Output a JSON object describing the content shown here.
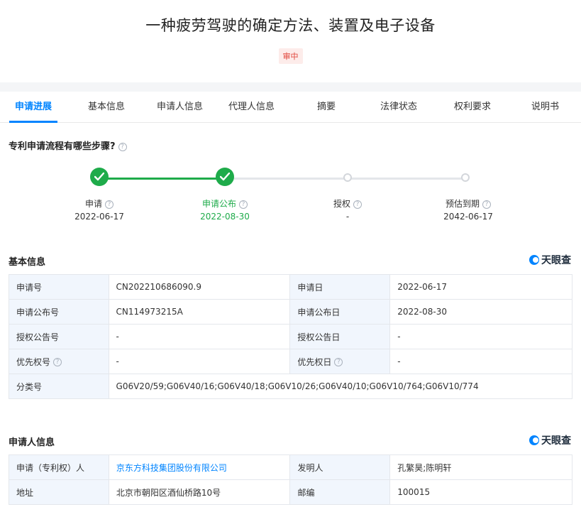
{
  "header": {
    "title": "一种疲劳驾驶的确定方法、装置及电子设备",
    "status": "审中"
  },
  "tabs": [
    "申请进展",
    "基本信息",
    "申请人信息",
    "代理人信息",
    "摘要",
    "法律状态",
    "权利要求",
    "说明书"
  ],
  "progress": {
    "heading": "专利申请流程有哪些步骤?",
    "steps": [
      {
        "label": "申请",
        "date": "2022-06-17",
        "done": true
      },
      {
        "label": "申请公布",
        "date": "2022-08-30",
        "done": true
      },
      {
        "label": "授权",
        "date": "-",
        "done": false
      },
      {
        "label": "预估到期",
        "date": "2042-06-17",
        "done": false
      }
    ]
  },
  "brand": "天眼查",
  "basic_info": {
    "heading": "基本信息",
    "rows": [
      {
        "k1": "申请号",
        "v1": "CN202210686090.9",
        "k2": "申请日",
        "v2": "2022-06-17"
      },
      {
        "k1": "申请公布号",
        "v1": "CN114973215A",
        "k2": "申请公布日",
        "v2": "2022-08-30"
      },
      {
        "k1": "授权公告号",
        "v1": "-",
        "k2": "授权公告日",
        "v2": "-"
      },
      {
        "k1": "优先权号",
        "v1": "-",
        "k2": "优先权日",
        "v2": "-"
      }
    ],
    "classification_label": "分类号",
    "classification_value": "G06V20/59;G06V40/16;G06V40/18;G06V10/26;G06V40/10;G06V10/764;G06V10/774"
  },
  "applicant_info": {
    "heading": "申请人信息",
    "applicant_label": "申请（专利权）人",
    "applicant_value": "京东方科技集团股份有限公司",
    "inventor_label": "发明人",
    "inventor_value": "孔繁昊;陈明轩",
    "address_label": "地址",
    "address_value": "北京市朝阳区酒仙桥路10号",
    "postcode_label": "邮编",
    "postcode_value": "100015"
  }
}
